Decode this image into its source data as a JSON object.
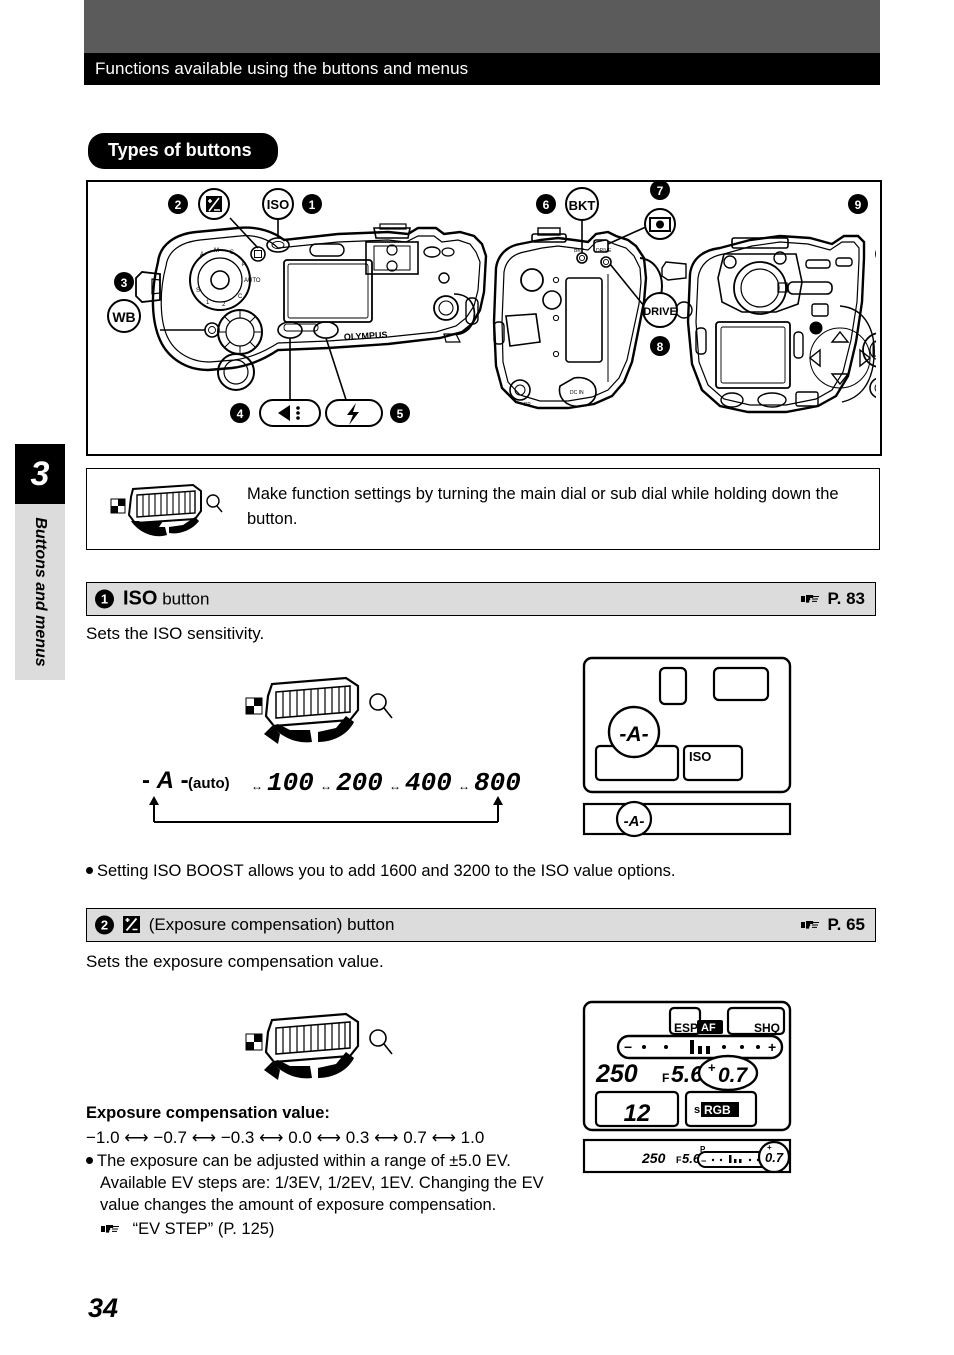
{
  "header": {
    "chapter_title": "Functions available using the buttons and menus",
    "grey_band_color": "#5b5b5b",
    "bar_color": "#000000"
  },
  "side_tab": {
    "chapter_number": "3",
    "chapter_label": "Buttons and menus",
    "label_bg": "#dcdcdc"
  },
  "section_pill": {
    "label": "Types of buttons"
  },
  "figure": {
    "brand": "OLYMPUS",
    "callouts": [
      {
        "number": "1",
        "icon_label": "ISO",
        "view": "top"
      },
      {
        "number": "2",
        "icon_label": "+/-",
        "view": "top"
      },
      {
        "number": "3",
        "icon_label": "WB",
        "view": "top"
      },
      {
        "number": "4",
        "icon_label": "quality",
        "view": "top"
      },
      {
        "number": "5",
        "icon_label": "flash",
        "view": "top"
      },
      {
        "number": "6",
        "icon_label": "BKT",
        "view": "side"
      },
      {
        "number": "7",
        "icon_label": "metering",
        "view": "side"
      },
      {
        "number": "8",
        "icon_label": "DRIVE",
        "view": "side"
      },
      {
        "number": "9",
        "icon_label": "AF-frame",
        "view": "back"
      }
    ]
  },
  "dial_note": {
    "text": "Make function settings by turning the main dial or sub dial while holding down the button.",
    "icon": "main-dial-rotate-icon"
  },
  "sections": [
    {
      "number": "1",
      "title_bold": "ISO",
      "title_rest": "button",
      "page_ref": "P. 83",
      "ref_icon": "pointing-hand-icon",
      "description": "Sets the ISO sensitivity.",
      "sequence": {
        "auto_label": "- A -",
        "auto_suffix": "(auto)",
        "values": [
          "100",
          "200",
          "400",
          "800"
        ],
        "wraps": true
      },
      "lcd": {
        "main_value": "-A-",
        "iso_label": "ISO",
        "viewfinder_value": "-A-"
      },
      "bullet": "Setting ISO BOOST allows you to add 1600 and 3200 to the ISO value options."
    },
    {
      "number": "2",
      "title_icon": "exposure-compensation-icon",
      "title_rest": "(Exposure compensation) button",
      "page_ref": "P. 65",
      "ref_icon": "pointing-hand-icon",
      "description": "Sets the exposure compensation value.",
      "value_heading": "Exposure compensation value:",
      "value_sequence": [
        "−1.0",
        "−0.7",
        "−0.3",
        "0.0",
        "0.3",
        "0.7",
        "1.0"
      ],
      "bullets": [
        "The exposure can be adjusted within a range of ±5.0 EV. Available EV steps are: 1/3EV, 1/2EV, 1EV. Changing the EV value changes the amount of exposure compensation.",
        "“EV STEP” (P. 125)"
      ],
      "lcd": {
        "esp": "ESP",
        "af": "AF",
        "shq": "SHQ",
        "scale_minus": "−",
        "scale_plus": "+",
        "shutter": "250",
        "aperture_prefix": "F",
        "aperture": "5.6",
        "comp_sign": "+",
        "comp_value": "0.7",
        "frames": "12",
        "colorspace_prefix": "s",
        "colorspace": "RGB",
        "viewfinder": {
          "shutter": "250",
          "aperture_prefix": "F",
          "aperture": "5.6",
          "mode": "P",
          "comp_value": "0.7"
        }
      }
    }
  ],
  "page_number": "34"
}
